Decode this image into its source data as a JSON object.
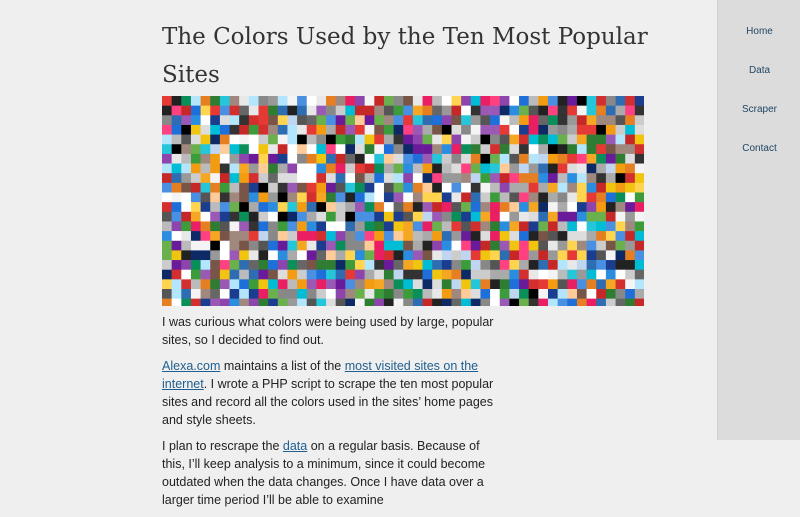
{
  "article": {
    "title": "The Colors Used by the Ten Most Popular Sites",
    "image": {
      "name": "color-mosaic"
    },
    "paragraphs": [
      {
        "text_a": "I was curious what colors were being used by large, popular sites, so I decided to find out."
      },
      {
        "link_a": "Alexa.com",
        "text_a": " maintains a list of the ",
        "link_b": "most visited sites on the internet",
        "text_b": ". I wrote a PHP script to scrape the ten most popular sites and record all the colors used in the sites’ home pages and style sheets."
      },
      {
        "text_a": "I plan to rescrape the ",
        "link_a": "data",
        "text_b": " on a regular basis. Because of this, I’ll keep analysis to a minimum, since it could become outdated when the data changes. Once I have data over a larger time period I’ll be able to examine"
      }
    ]
  },
  "sidebar": {
    "items": [
      {
        "label": "Home"
      },
      {
        "label": "Data"
      },
      {
        "label": "Scraper"
      },
      {
        "label": "Contact"
      }
    ]
  },
  "colors": {
    "background": "#efefef",
    "sidebar_bg": "#dcdcdc",
    "link": "#1f5f8f",
    "palette": [
      "#ffffff",
      "#ffffff",
      "#f4f4f4",
      "#e8e8e8",
      "#dddddd",
      "#cccccc",
      "#bbbbbb",
      "#aaaaaa",
      "#999999",
      "#888888",
      "#666666",
      "#555555",
      "#333333",
      "#222222",
      "#000000",
      "#1e6fd9",
      "#2b8de0",
      "#4a90e2",
      "#1a3d8f",
      "#0d2a66",
      "#2f6db3",
      "#3c9c3c",
      "#6ab04c",
      "#2e7d32",
      "#0a8f5a",
      "#d32f2f",
      "#e53935",
      "#c62828",
      "#f5a623",
      "#f39c12",
      "#e67e22",
      "#f1c40f",
      "#ffd54f",
      "#8e44ad",
      "#9b59b6",
      "#6a1b9a",
      "#e91e63",
      "#ff4081",
      "#00bcd4",
      "#26c6da",
      "#795548",
      "#a1887f",
      "#ffcc99",
      "#c0d6f0",
      "#b3e5fc"
    ]
  }
}
